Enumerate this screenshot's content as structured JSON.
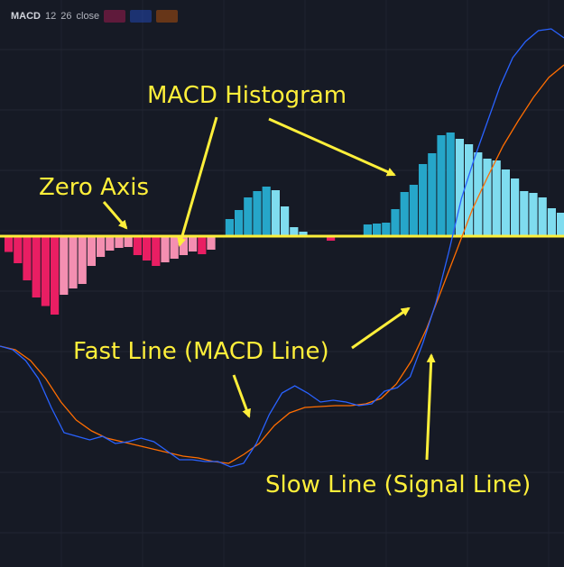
{
  "header": {
    "indicator_name": "MACD",
    "params": [
      "12",
      "26",
      "close"
    ],
    "swatch_colors": [
      "#e91e63",
      "#2962ff",
      "#ff6d00"
    ]
  },
  "annotations": {
    "histogram": "MACD Histogram",
    "zero_axis": "Zero Axis",
    "fast_line": "Fast Line (MACD Line)",
    "slow_line": "Slow Line (Signal Line)",
    "color": "#ffef3a"
  },
  "chart_data": {
    "type": "bar",
    "zero_line_color": "#ffef3a",
    "grid": true,
    "histogram": {
      "name": "",
      "colors": {
        "positive_rising": "#26a6c9",
        "positive_falling": "#7fdcef",
        "negative_falling": "#e91e63",
        "negative_rising": "#f48fb1"
      },
      "values": [
        -0.35,
        -0.6,
        -0.98,
        -1.36,
        -1.55,
        -1.74,
        -1.3,
        -1.16,
        -1.06,
        -0.66,
        -0.46,
        -0.32,
        -0.26,
        -0.24,
        -0.42,
        -0.54,
        -0.66,
        -0.58,
        -0.5,
        -0.42,
        -0.34,
        -0.4,
        -0.3,
        0,
        0.38,
        0.58,
        0.86,
        1.0,
        1.1,
        1.02,
        0.66,
        0.2,
        0.1,
        0,
        0,
        -0.1,
        0,
        0,
        0,
        0.26,
        0.28,
        0.3,
        0.6,
        0.98,
        1.14,
        1.6,
        1.84,
        2.24,
        2.3,
        2.16,
        2.04,
        1.86,
        1.72,
        1.68,
        1.48,
        1.28,
        1.0,
        0.96,
        0.86,
        0.62,
        0.52
      ],
      "ylim": [
        -2.0,
        3.0
      ]
    },
    "series": [
      {
        "name": "",
        "color": "#2962ff",
        "values": [
          2.8,
          2.6,
          2.0,
          1.0,
          -0.6,
          -2.0,
          -2.2,
          -2.4,
          -2.2,
          -2.6,
          -2.5,
          -2.3,
          -2.5,
          -3.0,
          -3.5,
          -3.5,
          -3.6,
          -3.6,
          -3.9,
          -3.7,
          -2.6,
          -1.0,
          0.2,
          0.6,
          0.2,
          -0.3,
          -0.2,
          -0.3,
          -0.5,
          -0.4,
          0.3,
          0.5,
          1.1,
          3.0,
          5.2,
          8.0,
          11.0,
          13.2,
          15.2,
          17.2,
          18.8,
          19.7,
          20.3,
          20.4,
          19.9
        ]
      },
      {
        "name": "",
        "color": "#ff6d00",
        "values": [
          2.8,
          2.6,
          2.0,
          1.0,
          -0.3,
          -1.3,
          -1.9,
          -2.3,
          -2.5,
          -2.7,
          -2.9,
          -3.1,
          -3.3,
          -3.4,
          -3.6,
          -3.7,
          -3.2,
          -2.6,
          -1.6,
          -0.9,
          -0.6,
          -0.55,
          -0.5,
          -0.5,
          -0.4,
          -0.1,
          0.7,
          2.0,
          3.8,
          6.0,
          8.2,
          10.4,
          12.2,
          13.9,
          15.3,
          16.6,
          17.7,
          18.4
        ]
      }
    ],
    "line_ylim": [
      -4.2,
      23.0
    ]
  }
}
